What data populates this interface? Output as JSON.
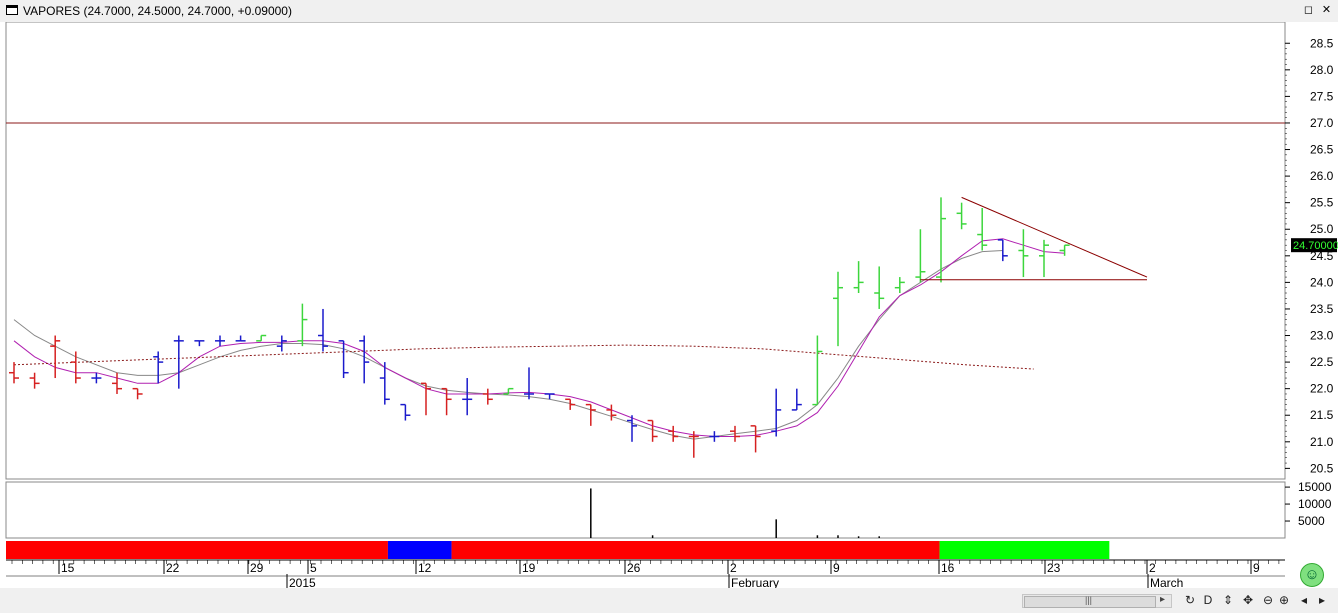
{
  "window": {
    "title": "VAPORES (24.7000, 24.5000, 24.7000, +0.09000)",
    "maximize_label": "◻",
    "close_label": "✕"
  },
  "colors": {
    "bar_up": "#3cd63c",
    "bar_down": "#d62020",
    "bar_neutral": "#1a1acc",
    "ma_fast": "#b020b0",
    "ma_slow": "#888888",
    "ma_long": "#8b1a1a",
    "trendline": "#8b0000",
    "price_tag_bg": "#000000",
    "price_tag_fg": "#33ff33",
    "strip_red": "#ff0000",
    "strip_blue": "#0000ff",
    "strip_green": "#00ff00"
  },
  "price_tag": "24.70000",
  "chart_data": [
    {
      "type": "ohlc",
      "title": "VAPORES (24.7000, 24.5000, 24.7000, +0.09000)",
      "y_ticks": [
        "28.5",
        "28.0",
        "27.5",
        "27.0",
        "26.5",
        "26.0",
        "25.5",
        "25.0",
        "24.5",
        "24.0",
        "23.5",
        "23.0",
        "22.5",
        "22.0",
        "21.5",
        "21.0",
        "20.5"
      ],
      "ylim": [
        20.3,
        28.9
      ],
      "horizontal_line": 27.0,
      "x_ticks": [
        "15",
        "22",
        "29",
        "5",
        "12",
        "19",
        "26",
        "2",
        "9",
        "16",
        "23",
        "2",
        "9"
      ],
      "x_month_labels": [
        "2015",
        "February",
        "March"
      ],
      "bars": [
        {
          "o": 22.3,
          "h": 22.5,
          "l": 22.1,
          "c": 22.2,
          "s": "down"
        },
        {
          "o": 22.2,
          "h": 22.3,
          "l": 22.0,
          "c": 22.1,
          "s": "down"
        },
        {
          "o": 22.8,
          "h": 23.0,
          "l": 22.2,
          "c": 22.9,
          "s": "down"
        },
        {
          "o": 22.5,
          "h": 22.7,
          "l": 22.1,
          "c": 22.2,
          "s": "down"
        },
        {
          "o": 22.2,
          "h": 22.3,
          "l": 22.1,
          "c": 22.2,
          "s": "neutral"
        },
        {
          "o": 22.1,
          "h": 22.3,
          "l": 21.9,
          "c": 22.0,
          "s": "down"
        },
        {
          "o": 22.0,
          "h": 22.0,
          "l": 21.8,
          "c": 21.9,
          "s": "down"
        },
        {
          "o": 22.6,
          "h": 22.7,
          "l": 22.1,
          "c": 22.5,
          "s": "neutral"
        },
        {
          "o": 22.9,
          "h": 23.0,
          "l": 22.0,
          "c": 22.9,
          "s": "neutral"
        },
        {
          "o": 22.9,
          "h": 22.9,
          "l": 22.8,
          "c": 22.9,
          "s": "neutral"
        },
        {
          "o": 22.9,
          "h": 23.0,
          "l": 22.8,
          "c": 22.9,
          "s": "neutral"
        },
        {
          "o": 22.9,
          "h": 23.0,
          "l": 22.9,
          "c": 22.9,
          "s": "neutral"
        },
        {
          "o": 22.9,
          "h": 23.0,
          "l": 22.9,
          "c": 23.0,
          "s": "up"
        },
        {
          "o": 22.8,
          "h": 23.0,
          "l": 22.7,
          "c": 22.9,
          "s": "neutral"
        },
        {
          "o": 22.9,
          "h": 23.6,
          "l": 22.8,
          "c": 23.3,
          "s": "up"
        },
        {
          "o": 23.0,
          "h": 23.5,
          "l": 22.7,
          "c": 22.8,
          "s": "neutral"
        },
        {
          "o": 22.9,
          "h": 22.9,
          "l": 22.2,
          "c": 22.3,
          "s": "neutral"
        },
        {
          "o": 22.9,
          "h": 23.0,
          "l": 22.1,
          "c": 22.5,
          "s": "neutral"
        },
        {
          "o": 22.2,
          "h": 22.5,
          "l": 21.7,
          "c": 21.8,
          "s": "neutral"
        },
        {
          "o": 21.7,
          "h": 21.7,
          "l": 21.4,
          "c": 21.5,
          "s": "neutral"
        },
        {
          "o": 22.1,
          "h": 22.1,
          "l": 21.5,
          "c": 22.0,
          "s": "down"
        },
        {
          "o": 22.0,
          "h": 22.0,
          "l": 21.5,
          "c": 21.8,
          "s": "down"
        },
        {
          "o": 21.8,
          "h": 22.2,
          "l": 21.5,
          "c": 21.8,
          "s": "neutral"
        },
        {
          "o": 21.9,
          "h": 22.0,
          "l": 21.7,
          "c": 21.8,
          "s": "down"
        },
        {
          "o": 21.9,
          "h": 22.0,
          "l": 21.9,
          "c": 22.0,
          "s": "up"
        },
        {
          "o": 21.9,
          "h": 22.4,
          "l": 21.8,
          "c": 21.9,
          "s": "neutral"
        },
        {
          "o": 21.9,
          "h": 21.9,
          "l": 21.8,
          "c": 21.9,
          "s": "neutral"
        },
        {
          "o": 21.8,
          "h": 21.8,
          "l": 21.6,
          "c": 21.7,
          "s": "down"
        },
        {
          "o": 21.7,
          "h": 21.7,
          "l": 21.3,
          "c": 21.6,
          "s": "down"
        },
        {
          "o": 21.6,
          "h": 21.7,
          "l": 21.4,
          "c": 21.5,
          "s": "down"
        },
        {
          "o": 21.4,
          "h": 21.5,
          "l": 21.0,
          "c": 21.3,
          "s": "neutral"
        },
        {
          "o": 21.4,
          "h": 21.4,
          "l": 21.0,
          "c": 21.1,
          "s": "down"
        },
        {
          "o": 21.2,
          "h": 21.3,
          "l": 21.0,
          "c": 21.1,
          "s": "down"
        },
        {
          "o": 21.1,
          "h": 21.2,
          "l": 20.7,
          "c": 21.1,
          "s": "down"
        },
        {
          "o": 21.1,
          "h": 21.2,
          "l": 21.0,
          "c": 21.1,
          "s": "neutral"
        },
        {
          "o": 21.2,
          "h": 21.3,
          "l": 21.0,
          "c": 21.1,
          "s": "down"
        },
        {
          "o": 21.3,
          "h": 21.3,
          "l": 20.8,
          "c": 21.1,
          "s": "down"
        },
        {
          "o": 21.2,
          "h": 22.0,
          "l": 21.1,
          "c": 21.6,
          "s": "neutral"
        },
        {
          "o": 21.6,
          "h": 22.0,
          "l": 21.6,
          "c": 21.7,
          "s": "neutral"
        },
        {
          "o": 21.7,
          "h": 23.0,
          "l": 21.7,
          "c": 22.7,
          "s": "up"
        },
        {
          "o": 23.7,
          "h": 24.2,
          "l": 22.8,
          "c": 23.9,
          "s": "up"
        },
        {
          "o": 23.9,
          "h": 24.4,
          "l": 23.8,
          "c": 24.0,
          "s": "up"
        },
        {
          "o": 23.8,
          "h": 24.3,
          "l": 23.5,
          "c": 23.7,
          "s": "up"
        },
        {
          "o": 23.9,
          "h": 24.1,
          "l": 23.8,
          "c": 24.0,
          "s": "up"
        },
        {
          "o": 24.1,
          "h": 25.0,
          "l": 24.0,
          "c": 24.2,
          "s": "up"
        },
        {
          "o": 24.1,
          "h": 25.6,
          "l": 24.0,
          "c": 25.2,
          "s": "up"
        },
        {
          "o": 25.3,
          "h": 25.5,
          "l": 25.0,
          "c": 25.1,
          "s": "up"
        },
        {
          "o": 24.9,
          "h": 25.4,
          "l": 24.6,
          "c": 24.7,
          "s": "up"
        },
        {
          "o": 24.8,
          "h": 24.8,
          "l": 24.4,
          "c": 24.5,
          "s": "neutral"
        },
        {
          "o": 24.6,
          "h": 25.0,
          "l": 24.1,
          "c": 24.5,
          "s": "up"
        },
        {
          "o": 24.5,
          "h": 24.8,
          "l": 24.1,
          "c": 24.7,
          "s": "up"
        },
        {
          "o": 24.6,
          "h": 24.7,
          "l": 24.5,
          "c": 24.7,
          "s": "up"
        }
      ],
      "ma_fast": [
        22.9,
        22.6,
        22.4,
        22.3,
        22.3,
        22.2,
        22.1,
        22.1,
        22.3,
        22.6,
        22.8,
        22.85,
        22.87,
        22.87,
        22.9,
        22.9,
        22.85,
        22.7,
        22.4,
        22.2,
        22.0,
        21.9,
        21.9,
        21.9,
        21.92,
        21.93,
        21.9,
        21.85,
        21.75,
        21.6,
        21.45,
        21.3,
        21.2,
        21.13,
        21.1,
        21.1,
        21.12,
        21.2,
        21.3,
        21.55,
        22.05,
        22.7,
        23.35,
        23.75,
        23.95,
        24.2,
        24.5,
        24.78,
        24.82,
        24.7,
        24.58,
        24.55
      ],
      "ma_slow": [
        23.3,
        23.0,
        22.8,
        22.6,
        22.45,
        22.3,
        22.25,
        22.25,
        22.3,
        22.45,
        22.6,
        22.72,
        22.8,
        22.85,
        22.85,
        22.83,
        22.75,
        22.6,
        22.4,
        22.2,
        22.05,
        21.97,
        21.93,
        21.9,
        21.88,
        21.85,
        21.8,
        21.72,
        21.6,
        21.48,
        21.35,
        21.23,
        21.12,
        21.05,
        21.1,
        21.15,
        21.2,
        21.25,
        21.4,
        21.7,
        22.2,
        22.8,
        23.3,
        23.75,
        24.0,
        24.25,
        24.45,
        24.58,
        24.6
      ],
      "ma_long": [
        22.45,
        22.5,
        22.55,
        22.6,
        22.65,
        22.7,
        22.75,
        22.78,
        22.8,
        22.82,
        22.8,
        22.75,
        22.65,
        22.55,
        22.45,
        22.37
      ],
      "trendline": [
        [
          46,
          25.6
        ],
        [
          55,
          24.1
        ]
      ],
      "support_line": [
        [
          44,
          24.05
        ],
        [
          55,
          24.05
        ]
      ],
      "volume": {
        "y_ticks": [
          "15000",
          "10000",
          "5000"
        ],
        "values": [
          0,
          0,
          0,
          0,
          0,
          0,
          0,
          0,
          0,
          0,
          0,
          0,
          0,
          0,
          0,
          0,
          0,
          0,
          0,
          0,
          0,
          0,
          0,
          0,
          0,
          0,
          0,
          0,
          14600,
          0,
          0,
          800,
          0,
          0,
          0,
          0,
          0,
          5500,
          0,
          800,
          800,
          500,
          500,
          0,
          0,
          0,
          0,
          0,
          0,
          0,
          0,
          0
        ]
      }
    }
  ],
  "signal_strip": [
    {
      "color": "red",
      "from": 0,
      "to": 18
    },
    {
      "color": "blue",
      "from": 18,
      "to": 21
    },
    {
      "color": "red",
      "from": 21,
      "to": 44
    },
    {
      "color": "green",
      "from": 44,
      "to": 52
    }
  ],
  "toolbar": {
    "scroll_grip": "|||",
    "left_arrow": "◂",
    "right_arrow": "▸",
    "buttons": [
      "◂",
      "▸",
      "↻",
      "D",
      "⇕",
      "✥",
      "⊖",
      "⊕",
      "◂",
      "▸",
      "⊟"
    ]
  }
}
